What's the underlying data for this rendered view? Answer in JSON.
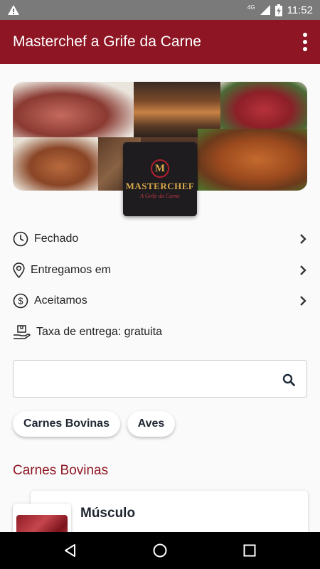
{
  "status_bar": {
    "time": "11:52",
    "network": "4G",
    "icons": [
      "warning-icon",
      "signal-icon",
      "battery-charging-icon"
    ]
  },
  "app_bar": {
    "title": "Masterchef a Grife da Carne",
    "menu_icon": "more-vert-icon",
    "color": "#8e1624"
  },
  "store": {
    "logo": {
      "initial": "M",
      "name": "MASTERCHEF",
      "tagline": "A Grife da Carne"
    }
  },
  "info": [
    {
      "icon": "clock-icon",
      "label": "Fechado",
      "has_chevron": true
    },
    {
      "icon": "location-pin-icon",
      "label": "Entregamos em",
      "has_chevron": true
    },
    {
      "icon": "dollar-circle-icon",
      "label": "Aceitamos",
      "has_chevron": true
    },
    {
      "icon": "delivery-hand-icon",
      "label": "Taxa de entrega: gratuita",
      "has_chevron": false
    }
  ],
  "search": {
    "placeholder": "",
    "value": "",
    "icon": "search-icon"
  },
  "categories": [
    "Carnes Bovinas",
    "Aves"
  ],
  "section": {
    "title": "Carnes Bovinas",
    "products": [
      {
        "name": "Músculo"
      }
    ]
  },
  "nav_bar": {
    "icons": [
      "back-icon",
      "home-icon",
      "recents-icon"
    ]
  }
}
